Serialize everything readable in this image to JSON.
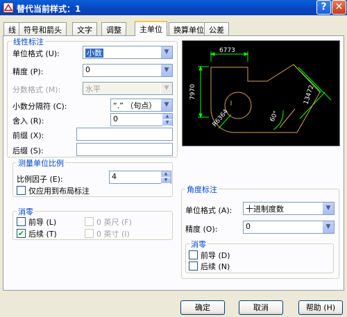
{
  "window": {
    "title": "替代当前样式：1",
    "help_btn": "?",
    "close_btn": "✕"
  },
  "tabs": [
    {
      "label": "线"
    },
    {
      "label": "符号和箭头"
    },
    {
      "label": "文字"
    },
    {
      "label": "调整"
    },
    {
      "label": "主单位",
      "active": true
    },
    {
      "label": "换算单位"
    },
    {
      "label": "公差"
    }
  ],
  "linear": {
    "legend": "线性标注",
    "unit_format_label": "单位格式 (U):",
    "unit_format_value": "小数",
    "precision_label": "精度 (P):",
    "precision_value": "0",
    "fraction_format_label": "分数格式 (M):",
    "fraction_format_value": "水平",
    "decimal_sep_label": "小数分隔符 (C):",
    "decimal_sep_value": "“.” （句点）",
    "roundoff_label": "舍入 (R):",
    "roundoff_value": "0",
    "prefix_label": "前缀 (X):",
    "prefix_value": "",
    "suffix_label": "后缀 (S):",
    "suffix_value": ""
  },
  "measure": {
    "legend": "测量单位比例",
    "scale_label": "比例因子 (E):",
    "scale_value": "4",
    "layout_only_label": "仅应用到布局标注"
  },
  "zero_linear": {
    "legend": "消零",
    "leading_label": "前导 (L)",
    "leading_checked": false,
    "trailing_label": "后续 (T)",
    "trailing_checked": true,
    "feet_label": "0 英尺 (F)",
    "inches_label": "0 英寸 (I)"
  },
  "preview": {
    "dim_top": "6773",
    "dim_left": "7970",
    "dim_right": "13472",
    "dim_radius": "R6364",
    "dim_angle": "60°"
  },
  "angular": {
    "legend": "角度标注",
    "unit_format_label": "单位格式 (A):",
    "unit_format_value": "十进制度数",
    "precision_label": "精度 (O):",
    "precision_value": "0",
    "zero_legend": "消零",
    "leading_label": "前导 (D)",
    "trailing_label": "后续 (N)"
  },
  "buttons": {
    "ok": "确定",
    "cancel": "取消",
    "help": "帮助 (H)"
  },
  "colors": {
    "title_bar": "#0A5FD8",
    "legend_text": "#0046D5",
    "selection": "#316AC5",
    "dim_green": "#00FF00",
    "geometry": "#D9A15A"
  }
}
